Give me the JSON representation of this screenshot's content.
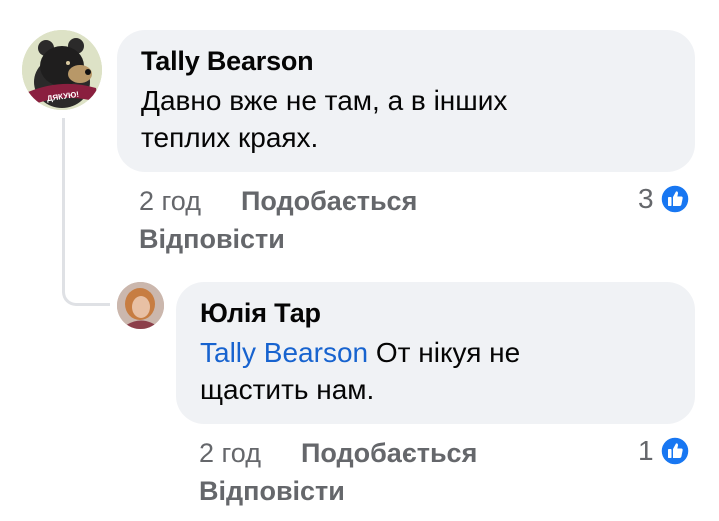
{
  "comments": [
    {
      "author": "Tally Bearson",
      "text_line1": "Давно вже не там, а  в інших",
      "text_line2": "теплих краях.",
      "badge_text": "ДЯКУЮ!",
      "time": "2 год",
      "like_label": "Подобається",
      "reply_label": "Відповісти",
      "reaction_count": "3"
    },
    {
      "author": "Юлія Тар",
      "mention": "Tally Bearson",
      "text_line1": "От нікуя не",
      "text_line2": "щастить нам.",
      "time": "2 год",
      "like_label": "Подобається",
      "reply_label": "Відповісти",
      "reaction_count": "1"
    }
  ],
  "colors": {
    "bubble": "#f0f2f5",
    "mention": "#1763cf",
    "meta": "#65676b",
    "like_icon": "#1877f2"
  }
}
